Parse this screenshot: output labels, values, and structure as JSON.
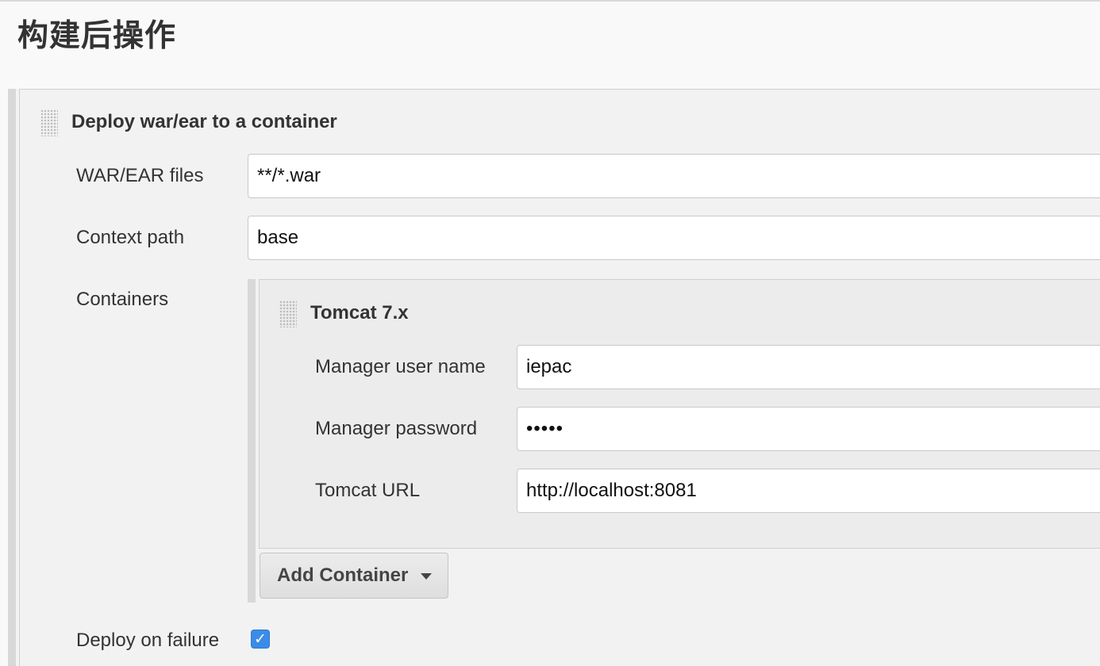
{
  "page": {
    "section_title": "构建后操作"
  },
  "deploy_block": {
    "title": "Deploy war/ear to a container",
    "war_files": {
      "label": "WAR/EAR files",
      "value": "**/*.war"
    },
    "context_path": {
      "label": "Context path",
      "value": "base"
    },
    "containers_label": "Containers",
    "tomcat": {
      "title": "Tomcat 7.x",
      "manager_user": {
        "label": "Manager user name",
        "value": "iepac"
      },
      "manager_password": {
        "label": "Manager password",
        "value": "•••••"
      },
      "tomcat_url": {
        "label": "Tomcat URL",
        "value": "http://localhost:8081"
      }
    },
    "add_container_label": "Add Container",
    "deploy_on_failure": {
      "label": "Deploy on failure",
      "checked": true,
      "check_glyph": "✓"
    }
  },
  "colors": {
    "checkbox_accent": "#3b8ce6",
    "panel_bg": "#f2f2f2",
    "tomcat_panel_bg": "#ececec"
  },
  "icons": {
    "drag_handle": "drag-handle-icon",
    "dropdown_caret": "caret-down-icon",
    "checkmark": "checkmark-icon"
  }
}
